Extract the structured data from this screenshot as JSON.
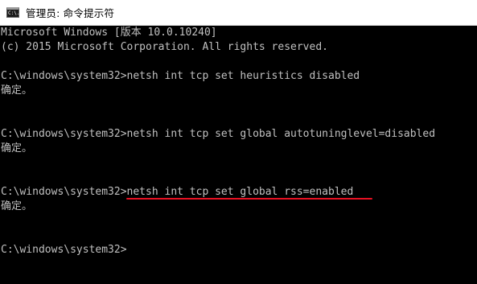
{
  "window": {
    "title": "管理员: 命令提示符",
    "icon": "cmd-console-icon",
    "icon_glyph": "C:\\."
  },
  "console": {
    "lines": [
      "Microsoft Windows [版本 10.0.10240]",
      "(c) 2015 Microsoft Corporation. All rights reserved.",
      "",
      "C:\\windows\\system32>netsh int tcp set heuristics disabled",
      "确定。",
      "",
      "",
      "C:\\windows\\system32>netsh int tcp set global autotuninglevel=disabled",
      "确定。",
      "",
      "",
      "C:\\windows\\system32>netsh int tcp set global rss=enabled",
      "确定。",
      "",
      "",
      "C:\\windows\\system32>"
    ],
    "highlight_color": "#e81123"
  }
}
